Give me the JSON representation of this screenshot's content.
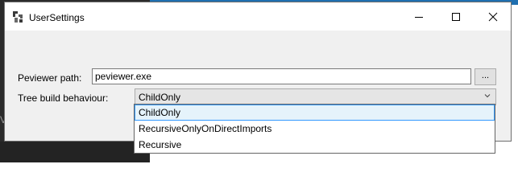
{
  "window": {
    "title": "UserSettings",
    "controls": {
      "minimize_icon": "minimize-icon",
      "maximize_icon": "maximize-icon",
      "close_icon": "close-icon"
    }
  },
  "background": {
    "glyph": "V"
  },
  "form": {
    "peviewer_path": {
      "label": "Peviewer path:",
      "value": "peviewer.exe",
      "browse_label": "..."
    },
    "tree_build": {
      "label": "Tree build behaviour:",
      "selected": "ChildOnly",
      "options": [
        "ChildOnly",
        "RecursiveOnlyOnDirectImports",
        "Recursive"
      ],
      "highlighted_index": 0
    }
  },
  "colors": {
    "accent_blue": "#1f6fb0",
    "selection_border": "#3399ff",
    "selection_fill": "#e5f3fb",
    "dark_background": "#2b2b2b"
  }
}
